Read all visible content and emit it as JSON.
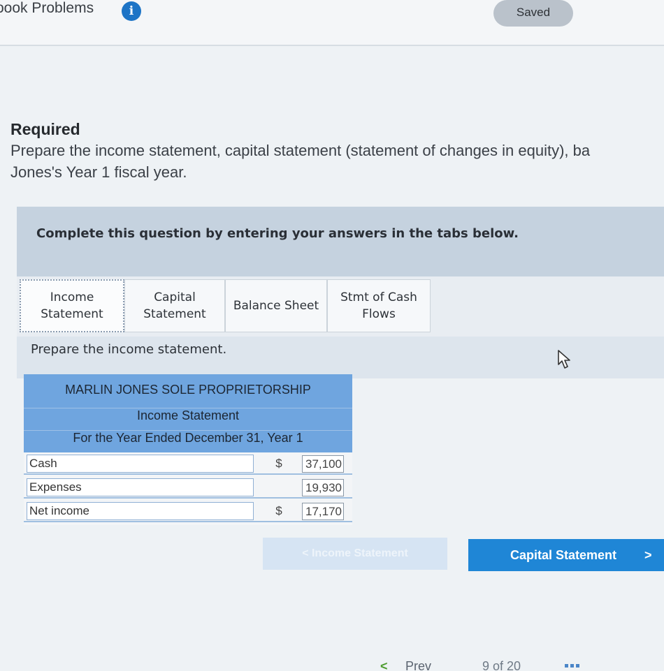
{
  "header": {
    "title": "oook Problems",
    "info_icon": "info-icon",
    "saved_label": "Saved"
  },
  "required": {
    "heading": "Required",
    "text_line1": "Prepare the income statement, capital statement (statement of changes in equity), ba",
    "text_line2": "Jones's Year 1 fiscal year."
  },
  "instruction": "Complete this question by entering your answers in the tabs below.",
  "tabs": [
    {
      "label_line1": "Income",
      "label_line2": "Statement",
      "active": true
    },
    {
      "label_line1": "Capital",
      "label_line2": "Statement",
      "active": false
    },
    {
      "label_line1": "Balance Sheet",
      "label_line2": "",
      "active": false
    },
    {
      "label_line1": "Stmt of Cash",
      "label_line2": "Flows",
      "active": false
    }
  ],
  "tab_prompt": "Prepare the income statement.",
  "statement": {
    "company": "MARLIN JONES SOLE PROPRIETORSHIP",
    "title": "Income Statement",
    "period": "For the Year Ended December 31, Year 1",
    "rows": [
      {
        "label": "Cash",
        "dollar": "$",
        "value": "37,100"
      },
      {
        "label": "Expenses",
        "dollar": "",
        "value": "19,930"
      },
      {
        "label": "Net income",
        "dollar": "$",
        "value": "17,170"
      }
    ]
  },
  "buttons": {
    "prev_tab_label": "< Income Statement",
    "next_tab_label": "Capital Statement",
    "next_chevron": ">"
  },
  "pager": {
    "prev_chevron": "<",
    "prev_label": "Prev",
    "counter": "9 of 20"
  },
  "colors": {
    "accent": "#1f86d6",
    "header_band": "#6fa5df",
    "info_icon": "#1d74c6"
  }
}
